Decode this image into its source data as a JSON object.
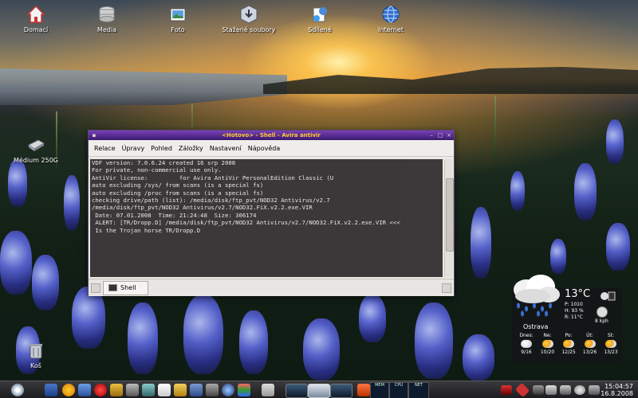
{
  "desktop_icons": [
    {
      "name": "home-icon",
      "label": "Domací"
    },
    {
      "name": "media-icon",
      "label": "Media"
    },
    {
      "name": "photo-icon",
      "label": "Foto"
    },
    {
      "name": "downloads-icon",
      "label": "Stažené soubory"
    },
    {
      "name": "shared-icon",
      "label": "Sdílené"
    },
    {
      "name": "internet-icon",
      "label": "Internet"
    }
  ],
  "drive_icon": {
    "label": "Médium 250G"
  },
  "trash_icon": {
    "label": "Koš"
  },
  "window": {
    "title": "<Hotovo> - Shell - Avira antivir",
    "menu": [
      "Relace",
      "Úpravy",
      "Pohled",
      "Záložky",
      "Nastavení",
      "Nápověda"
    ],
    "terminal_lines": [
      "",
      "VDF version: 7.0.6.24 created 16 srp 2008",
      "",
      "For private, non-commercial use only.",
      "AntiVir license:         for Avira AntiVir PersonalEdition Classic (U",
      "",
      "auto excluding /sys/ from scans (is a special fs)",
      "auto excluding /proc from scans (is a special fs)",
      "checking drive/path (list): /media/disk/ftp_pvt/NOD32 Antivirus/v2.7",
      "/media/disk/ftp_pvt/NOD32 Antivirus/v2.7/NOD32.FiX.v2.2.exe.VIR",
      " Date: 07.01.2008  Time: 21:24:48  Size: 306174",
      " ALERT: [TR/Dropp.D] /media/disk/ftp_pvt/NOD32 Antivirus/v2.7/NOD32.FiX.v2.2.exe.VIR <<<",
      " Is the Trojan horse TR/Dropp.D"
    ],
    "tab_label": "Shell"
  },
  "weather": {
    "temp": "13°C",
    "p": "P: 1010",
    "h": "H: 93 %",
    "r": "R: 11°C",
    "wind": "8 kph",
    "city": "Ostrava",
    "forecast": [
      {
        "day": "Dnes:",
        "temp": "9/16"
      },
      {
        "day": "Ne:",
        "temp": "10/20"
      },
      {
        "day": "Po:",
        "temp": "12/25"
      },
      {
        "day": "Út:",
        "temp": "13/26"
      },
      {
        "day": "St:",
        "temp": "13/23"
      }
    ]
  },
  "taskbar": {
    "monitor_labels": [
      "MEM",
      "CPU",
      "NET"
    ],
    "time": "15:04:57",
    "date": "16.8.2008"
  },
  "colors": {
    "title_text": "#ffcc33",
    "titlebar": "#5a2a94",
    "terminal_bg": "#1e1a1c"
  }
}
